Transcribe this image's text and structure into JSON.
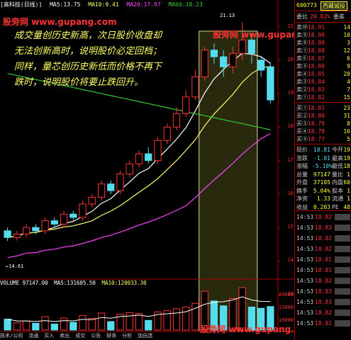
{
  "header": {
    "title": "[高科技(日线)]",
    "ma5": "MA5:13.75",
    "ma10": "MA10:9.41",
    "ma20": "MA20:17.97",
    "ma60": "MA60:18.23",
    "colors": {
      "ma5": "#ffffff",
      "ma10": "#ffff66",
      "ma20": "#ff44ff",
      "ma60": "#33cc33"
    }
  },
  "annotation": {
    "text": "成交量创历史新高，次日股价收盘却无法创新高时，说明股价必定回档；同样，量芯创历史新低而价格不再下跌时，说明股价将要止跌回升。"
  },
  "labels": {
    "peak": "21.13",
    "low": "←14.61"
  },
  "watermarks": {
    "top_left": "股旁网 www.gupang.com",
    "top_right": "股旁网 www.gupang.com",
    "bottom": "股旁网 www.gupang.com"
  },
  "price_axis": [
    "21",
    "20",
    "19",
    "18",
    "17",
    "16",
    "15",
    "14",
    "13"
  ],
  "volume": {
    "label": "VOLUME 97147.00",
    "ma5": "MA5:131605.50",
    "ma10": "MA10:120033.30",
    "axis": [
      "20000",
      "15000",
      "10000"
    ]
  },
  "bottom_tabs": [
    "技术/公司",
    "流通",
    "买入",
    "卖出",
    "成交",
    "公告",
    "财务",
    "分析",
    "加自选"
  ],
  "panel": {
    "code": "600773",
    "name": "西藏城投",
    "commission": {
      "label": "委比",
      "v1": "29.82%",
      "v2": "委差"
    },
    "asks": [
      {
        "label": "卖⑩",
        "price": "18.91",
        "vol": "14"
      },
      {
        "label": "卖⑨",
        "price": "18.90",
        "vol": "10"
      },
      {
        "label": "卖⑧",
        "price": "18.89",
        "vol": "3"
      },
      {
        "label": "卖⑦",
        "price": "18.88",
        "vol": "12"
      },
      {
        "label": "卖⑥",
        "price": "18.87",
        "vol": "6"
      },
      {
        "label": "卖⑤",
        "price": "18.86",
        "vol": "9"
      },
      {
        "label": "卖④",
        "price": "18.85",
        "vol": "20"
      },
      {
        "label": "卖③",
        "price": "18.84",
        "vol": "4"
      },
      {
        "label": "卖②",
        "price": "18.83",
        "vol": "7"
      },
      {
        "label": "卖①",
        "price": "18.82",
        "vol": "15"
      }
    ],
    "bids": [
      {
        "label": "买①",
        "price": "18.81",
        "vol": "23"
      },
      {
        "label": "买②",
        "price": "18.80",
        "vol": "31"
      },
      {
        "label": "买③",
        "price": "18.79",
        "vol": "8"
      },
      {
        "label": "买④",
        "price": "18.78",
        "vol": "16"
      },
      {
        "label": "买⑤",
        "price": "18.77",
        "vol": "5"
      }
    ],
    "stats": [
      {
        "label": "现价",
        "v1": "18.81",
        "v2": "今开",
        "v3": "19"
      },
      {
        "label": "涨跌",
        "v1": "-1.01",
        "v2": "最高",
        "v3": "19"
      },
      {
        "label": "涨幅",
        "v1": "-5.10%",
        "v2": "最低",
        "v3": "18"
      },
      {
        "label": "总量",
        "v1": "97147",
        "v2": "量比",
        "v3": "1"
      },
      {
        "label": "外盘",
        "v1": "37105",
        "v2": "内盘",
        "v3": "60"
      },
      {
        "label": "换手",
        "v1": "5.04%",
        "v2": "股本",
        "v3": "1"
      },
      {
        "label": "净资",
        "v1": "1.33",
        "v2": "流通",
        "v3": "1"
      },
      {
        "label": "收益",
        "v1": "0.203",
        "v2": "PE",
        "v3": "48"
      }
    ],
    "ticks": [
      {
        "time": "14:53",
        "price": "18.82"
      },
      {
        "time": "14:53",
        "price": "18.83"
      },
      {
        "time": "14:53",
        "price": "18.82"
      },
      {
        "time": "14:53",
        "price": "18.82"
      },
      {
        "time": "14:53",
        "price": "18.81"
      },
      {
        "time": "14:53",
        "price": "18.81"
      },
      {
        "time": "14:53",
        "price": "18.82"
      },
      {
        "time": "14:53",
        "price": "18.83"
      },
      {
        "time": "14:53",
        "price": "18.83"
      },
      {
        "time": "14:53",
        "price": "18.82"
      },
      {
        "time": "14:53",
        "price": "18.81"
      }
    ]
  },
  "chart_data": {
    "type": "candlestick",
    "ylim": [
      13.5,
      21.5
    ],
    "candles": [
      {
        "o": 14.9,
        "c": 14.7,
        "h": 15.0,
        "l": 14.6
      },
      {
        "o": 14.7,
        "c": 14.8,
        "h": 14.9,
        "l": 14.61
      },
      {
        "o": 14.8,
        "c": 15.0,
        "h": 15.1,
        "l": 14.7
      },
      {
        "o": 15.0,
        "c": 14.9,
        "h": 15.1,
        "l": 14.8
      },
      {
        "o": 14.9,
        "c": 15.2,
        "h": 15.3,
        "l": 14.8
      },
      {
        "o": 15.2,
        "c": 15.1,
        "h": 15.3,
        "l": 15.0
      },
      {
        "o": 15.1,
        "c": 15.4,
        "h": 15.5,
        "l": 15.0
      },
      {
        "o": 15.4,
        "c": 15.3,
        "h": 15.5,
        "l": 15.2
      },
      {
        "o": 15.3,
        "c": 15.7,
        "h": 15.8,
        "l": 15.2
      },
      {
        "o": 15.7,
        "c": 15.9,
        "h": 16.0,
        "l": 15.6
      },
      {
        "o": 15.9,
        "c": 16.3,
        "h": 16.4,
        "l": 15.8
      },
      {
        "o": 16.3,
        "c": 16.1,
        "h": 16.4,
        "l": 16.0
      },
      {
        "o": 16.1,
        "c": 16.6,
        "h": 16.7,
        "l": 16.0
      },
      {
        "o": 16.6,
        "c": 16.9,
        "h": 17.0,
        "l": 16.5
      },
      {
        "o": 16.9,
        "c": 17.2,
        "h": 17.3,
        "l": 16.8
      },
      {
        "o": 17.2,
        "c": 17.0,
        "h": 17.4,
        "l": 16.9
      },
      {
        "o": 17.0,
        "c": 17.6,
        "h": 17.7,
        "l": 16.9
      },
      {
        "o": 17.6,
        "c": 18.0,
        "h": 18.1,
        "l": 17.5
      },
      {
        "o": 18.0,
        "c": 18.4,
        "h": 18.6,
        "l": 17.9
      },
      {
        "o": 18.4,
        "c": 18.9,
        "h": 19.1,
        "l": 18.3
      },
      {
        "o": 18.9,
        "c": 19.5,
        "h": 19.7,
        "l": 18.8
      },
      {
        "o": 19.5,
        "c": 20.3,
        "h": 20.4,
        "l": 19.4
      },
      {
        "o": 20.3,
        "c": 20.1,
        "h": 20.5,
        "l": 19.9
      },
      {
        "o": 20.1,
        "c": 19.8,
        "h": 20.3,
        "l": 19.5
      },
      {
        "o": 19.8,
        "c": 20.2,
        "h": 20.4,
        "l": 19.6
      },
      {
        "o": 20.2,
        "c": 20.6,
        "h": 21.13,
        "l": 20.0
      },
      {
        "o": 20.6,
        "c": 20.2,
        "h": 20.8,
        "l": 19.9
      },
      {
        "o": 20.0,
        "c": 19.7,
        "h": 20.1,
        "l": 19.5
      },
      {
        "o": 19.8,
        "c": 18.81,
        "h": 19.9,
        "l": 18.7
      }
    ],
    "volumes": [
      45,
      30,
      38,
      28,
      55,
      25,
      50,
      32,
      60,
      48,
      70,
      35,
      66,
      72,
      68,
      40,
      75,
      80,
      88,
      95,
      110,
      160,
      120,
      100,
      130,
      175,
      95,
      90,
      97
    ]
  }
}
